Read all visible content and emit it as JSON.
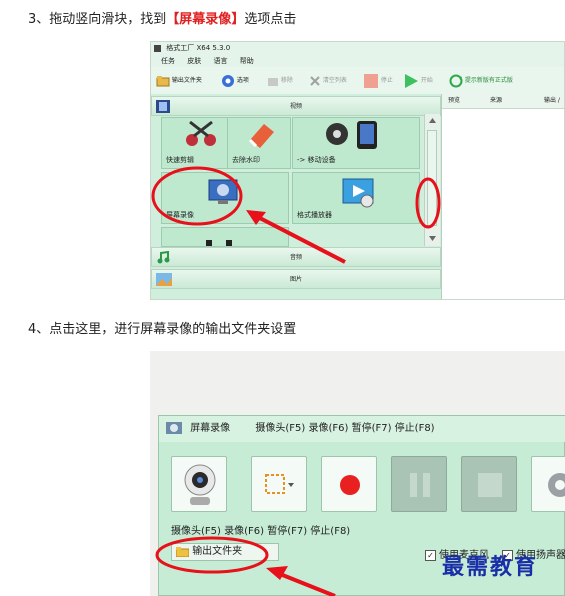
{
  "step3": {
    "prefix": "3、拖动竖向滑块，找到",
    "bracket_open": "【",
    "highlight": "屏幕录像",
    "bracket_close": "】",
    "suffix": "选项点击"
  },
  "step4": {
    "text": "4、点击这里，进行屏幕录像的输出文件夹设置"
  },
  "app1": {
    "title": "格式工厂 X64 5.3.0",
    "menu": [
      "任务",
      "皮肤",
      "语言",
      "帮助"
    ],
    "toolbar": {
      "output_folder": "输出文件夹",
      "options": "选项",
      "remove": "移除",
      "clear_list": "清空列表",
      "stop": "停止",
      "start": "开始",
      "promo": "提示新版有正式版"
    },
    "sections": {
      "video": "视频",
      "audio": "音频",
      "image": "图片"
    },
    "tiles": {
      "quick_clip": "快速剪辑",
      "remove_watermark": "去除水印",
      "to_mobile": "-> 移动设备",
      "screen_record": "屏幕录像",
      "format_player": "格式播放器"
    },
    "list_headers": {
      "preview": "预览",
      "source": "来源",
      "output": "输出 /"
    }
  },
  "app2": {
    "title": "屏幕录像",
    "title_hotkeys": "摄像头(F5) 录像(F6) 暂停(F7) 停止(F8)",
    "hotkeys": "摄像头(F5) 录像(F6) 暂停(F7) 停止(F8)",
    "output_folder": "输出文件夹",
    "checkbox1": "使用麦克风",
    "checkbox2": "使用扬声器",
    "checkbox_mark": "✓"
  },
  "watermark": "最需教育",
  "colors": {
    "highlight_red": "#e02020",
    "annotation_red": "#e8101a",
    "app_green": "#cfeedb",
    "watermark_blue": "#1a2ea8"
  }
}
